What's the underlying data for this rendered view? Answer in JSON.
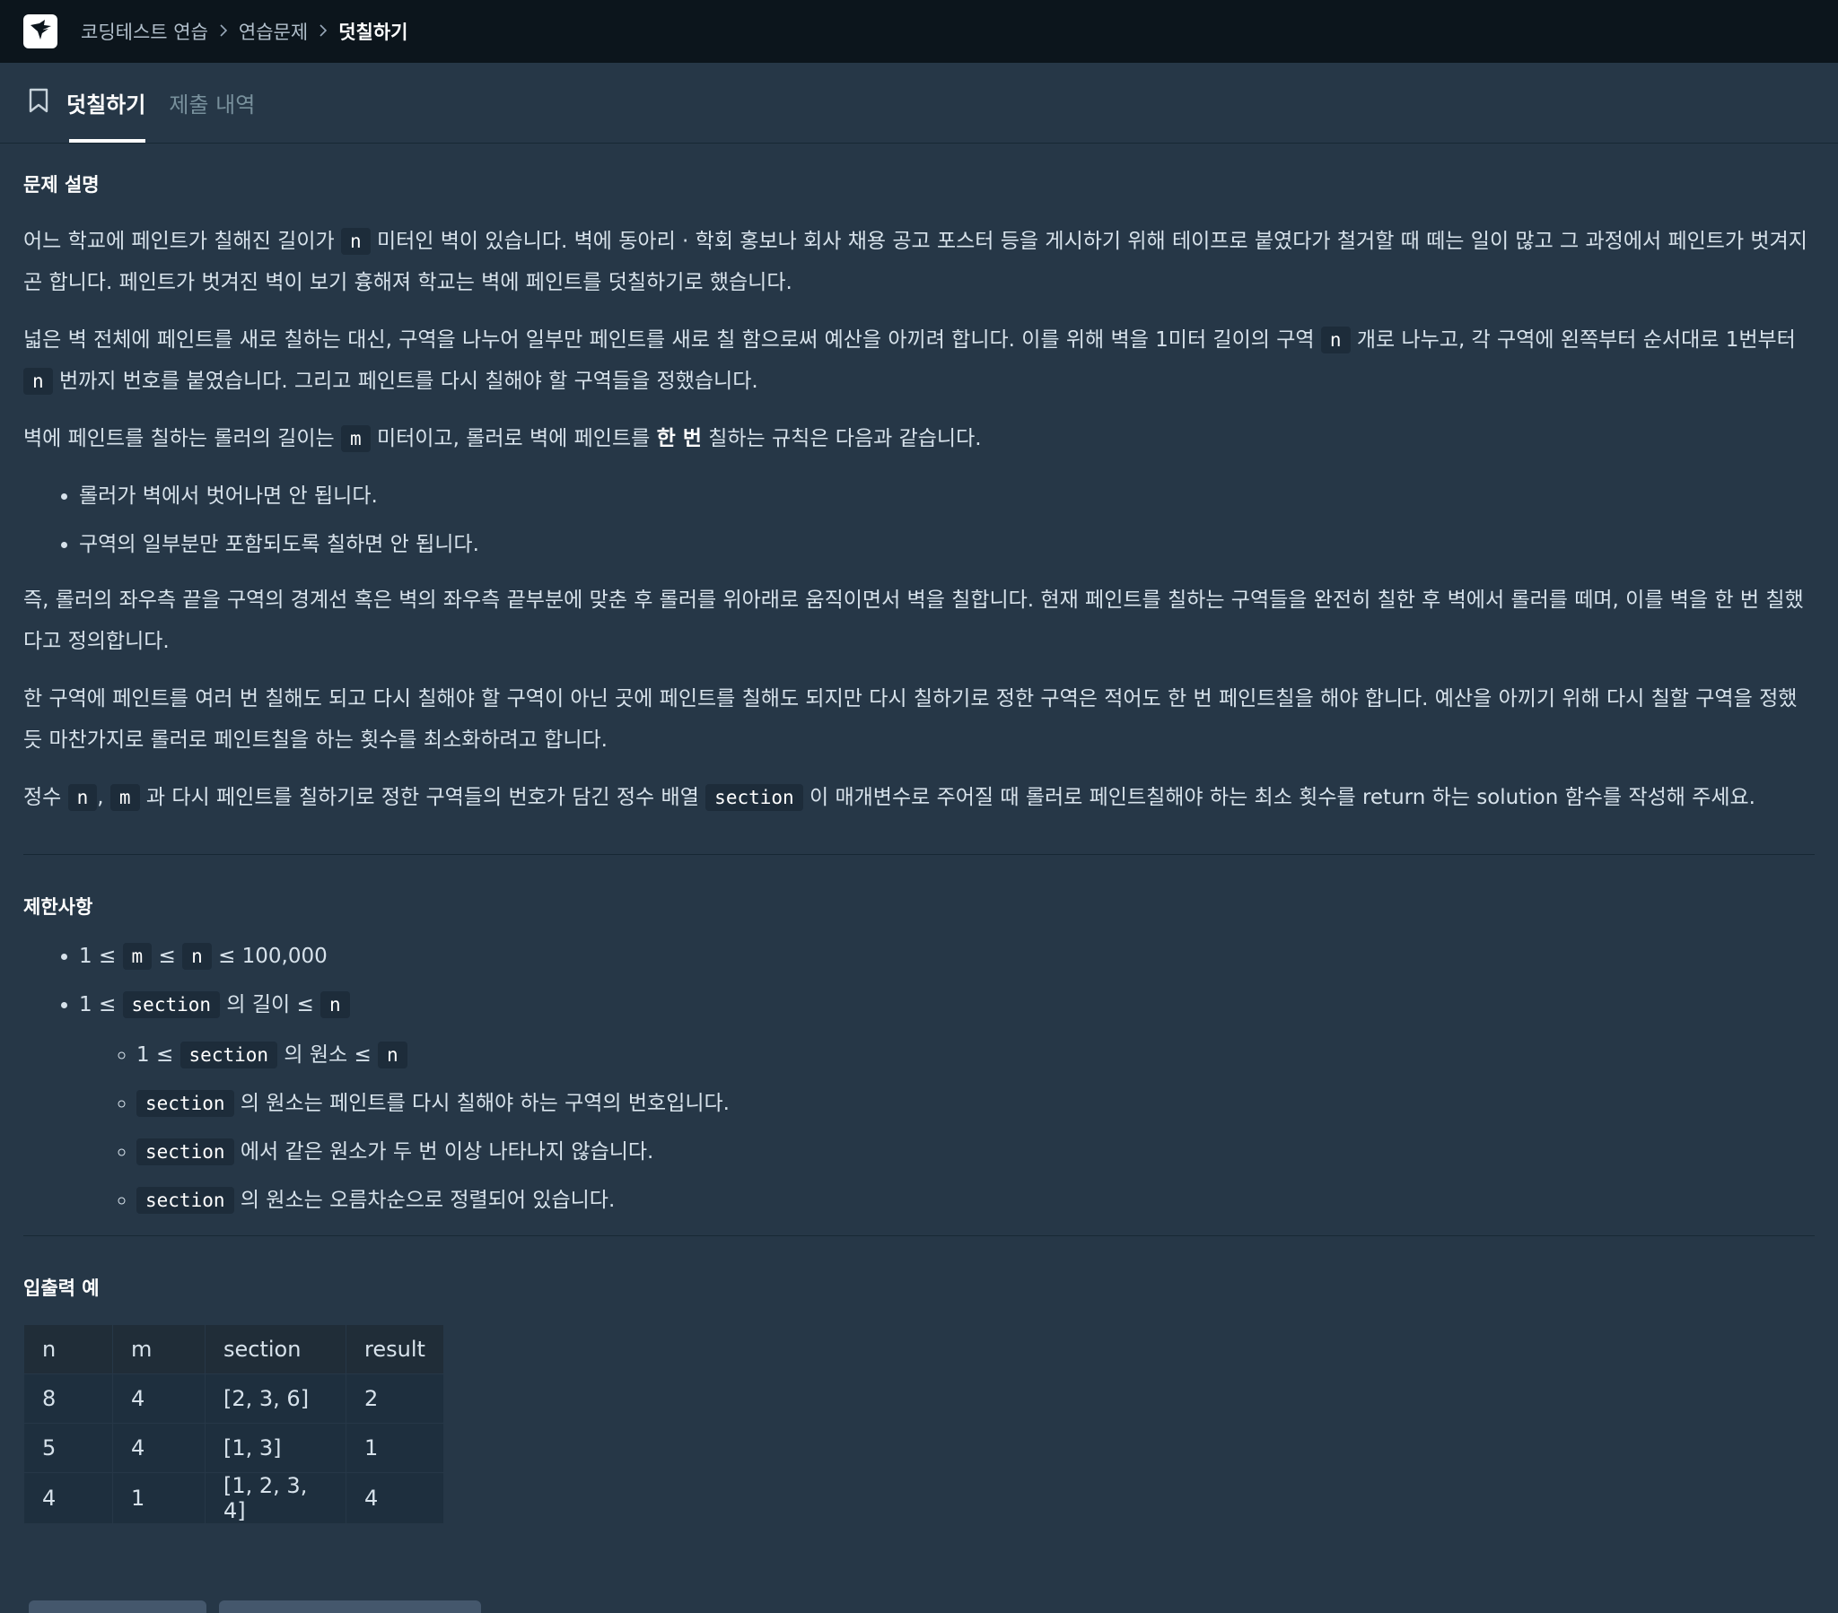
{
  "breadcrumb": [
    "코딩테스트 연습",
    "연습문제",
    "덧칠하기"
  ],
  "tabs": [
    {
      "label": "덧칠하기",
      "active": true
    },
    {
      "label": "제출 내역",
      "active": false
    }
  ],
  "sections": {
    "description_title": "문제 설명",
    "constraints_title": "제한사항",
    "examples_title": "입출력 예"
  },
  "paragraphs": {
    "p1a": "어느 학교에 페인트가 칠해진 길이가",
    "p1b": "미터인 벽이 있습니다. 벽에 동아리 · 학회 홍보나 회사 채용 공고 포스터 등을 게시하기 위해 테이프로 붙였다가 철거할 때 떼는 일이 많고 그 과정에서 페인트가 벗겨지곤 합니다. 페인트가 벗겨진 벽이 보기 흉해져 학교는 벽에 페인트를 덧칠하기로 했습니다.",
    "p2a": "넓은 벽 전체에 페인트를 새로 칠하는 대신, 구역을 나누어 일부만 페인트를 새로 칠 함으로써 예산을 아끼려 합니다. 이를 위해 벽을 1미터 길이의 구역",
    "p2b": "개로 나누고, 각 구역에 왼쪽부터 순서대로 1번부터",
    "p2c": "번까지 번호를 붙였습니다. 그리고 페인트를 다시 칠해야 할 구역들을 정했습니다.",
    "p3a": "벽에 페인트를 칠하는 롤러의 길이는",
    "p3b": "미터이고, 롤러로 벽에 페인트를",
    "p3bold": "한 번",
    "p3c": "칠하는 규칙은 다음과 같습니다.",
    "rule1": "롤러가 벽에서 벗어나면 안 됩니다.",
    "rule2": "구역의 일부분만 포함되도록 칠하면 안 됩니다.",
    "p4": "즉, 롤러의 좌우측 끝을 구역의 경계선 혹은 벽의 좌우측 끝부분에 맞춘 후 롤러를 위아래로 움직이면서 벽을 칠합니다. 현재 페인트를 칠하는 구역들을 완전히 칠한 후 벽에서 롤러를 떼며, 이를 벽을 한 번 칠했다고 정의합니다.",
    "p5": "한 구역에 페인트를 여러 번 칠해도 되고 다시 칠해야 할 구역이 아닌 곳에 페인트를 칠해도 되지만 다시 칠하기로 정한 구역은 적어도 한 번 페인트칠을 해야 합니다. 예산을 아끼기 위해 다시 칠할 구역을 정했듯 마찬가지로 롤러로 페인트칠을 하는 횟수를 최소화하려고 합니다.",
    "p6a": "정수",
    "p6b": ",",
    "p6c": "과 다시 페인트를 칠하기로 정한 구역들의 번호가 담긴 정수 배열",
    "p6d": "이 매개변수로 주어질 때 롤러로 페인트칠해야 하는 최소 횟수를 return 하는 solution 함수를 작성해 주세요."
  },
  "code": {
    "n": "n",
    "m": "m",
    "section": "section"
  },
  "constraints": {
    "c1a": "1 ≤",
    "c1b": "≤",
    "c1c": "≤ 100,000",
    "c2a": "1 ≤",
    "c2b": "의 길이 ≤",
    "s1a": "1 ≤",
    "s1b": "의 원소 ≤",
    "s2": "의 원소는 페인트를 다시 칠해야 하는 구역의 번호입니다.",
    "s3": "에서 같은 원소가 두 번 이상 나타나지 않습니다.",
    "s4": "의 원소는 오름차순으로 정렬되어 있습니다."
  },
  "table": {
    "headers": [
      "n",
      "m",
      "section",
      "result"
    ],
    "rows": [
      [
        "8",
        "4",
        "[2, 3, 6]",
        "2"
      ],
      [
        "5",
        "4",
        "[1, 3]",
        "1"
      ],
      [
        "4",
        "1",
        "[1, 2, 3, 4]",
        "4"
      ]
    ]
  }
}
